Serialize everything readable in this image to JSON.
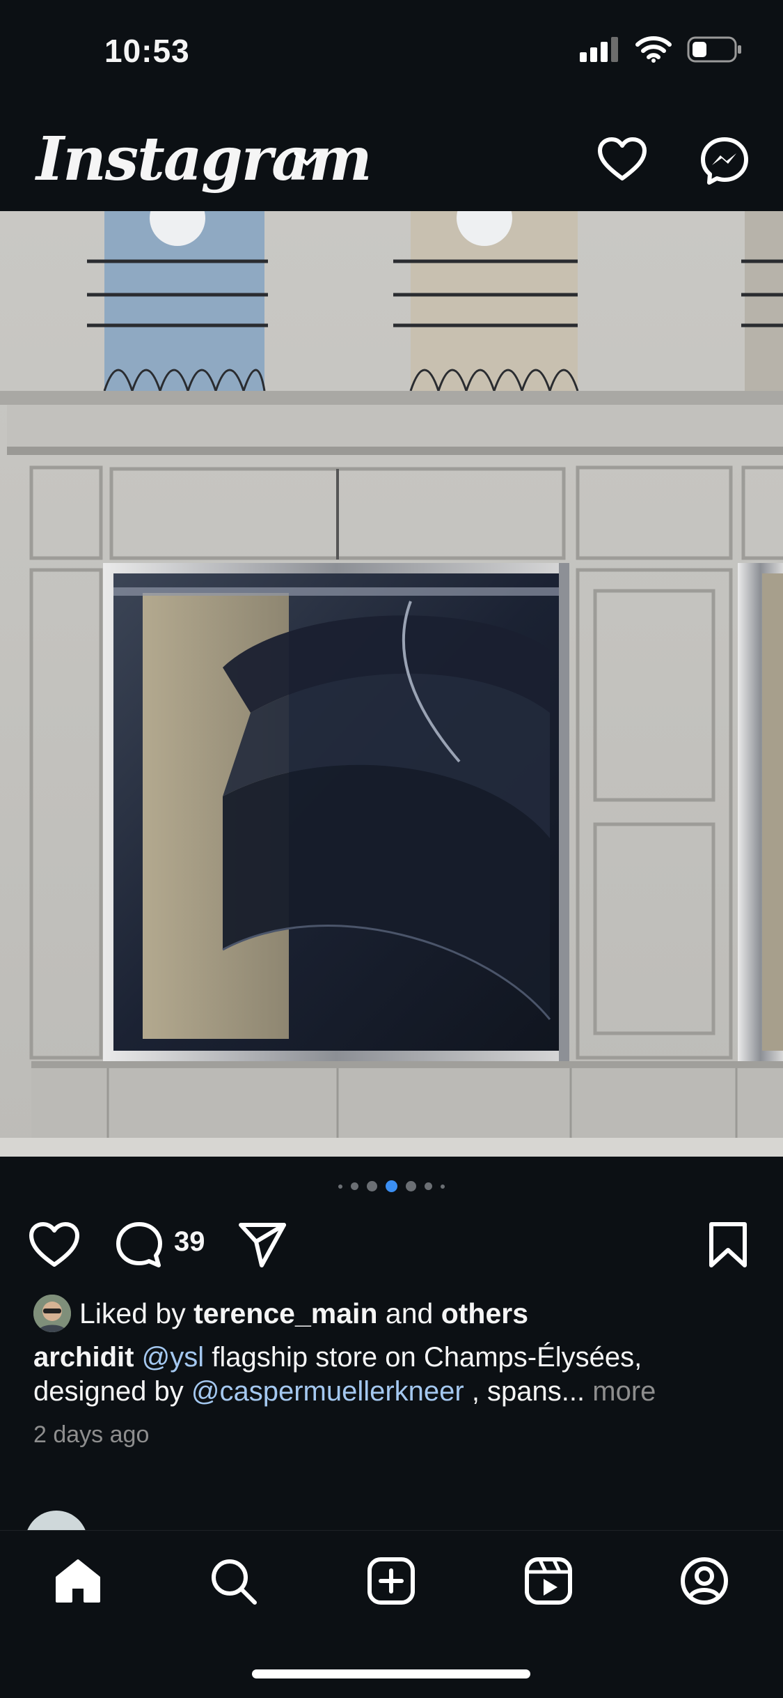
{
  "status_bar": {
    "time": "10:53"
  },
  "header": {
    "logo_text": "Instagram"
  },
  "post": {
    "comment_count": "39",
    "carousel": {
      "total": 7,
      "active_index": 3
    },
    "likes": {
      "prefix": "Liked by",
      "user": "terence_main",
      "and": "and",
      "others": "others"
    },
    "caption": {
      "author": "archidit",
      "mention1": "@ysl",
      "text1": " flagship store on Champs-Élysées, designed by ",
      "mention2": "@caspermuellerkneer",
      "text2": " , spans...",
      "more": "more"
    },
    "time_ago": "2 days ago"
  },
  "colors": {
    "background": "#0c1014",
    "mention": "#a4c8f0",
    "active_dot": "#3b8ff3"
  },
  "nav": {
    "icons": [
      "home-icon",
      "search-icon",
      "create-icon",
      "reels-icon",
      "profile-icon"
    ]
  }
}
